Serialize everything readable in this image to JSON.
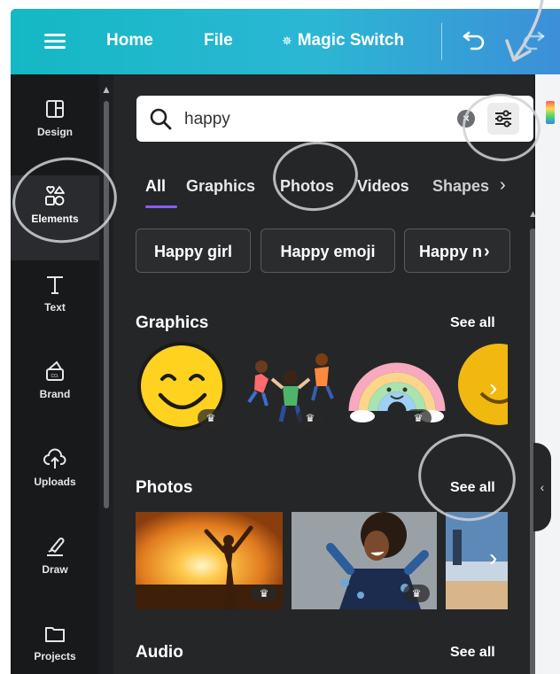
{
  "topbar": {
    "home": "Home",
    "file": "File",
    "magic_switch": "Magic Switch",
    "magic_icon": "✵"
  },
  "sidebar": {
    "items": [
      {
        "label": "Design",
        "icon": "design-icon"
      },
      {
        "label": "Elements",
        "icon": "elements-icon",
        "active": true
      },
      {
        "label": "Text",
        "icon": "text-icon"
      },
      {
        "label": "Brand",
        "icon": "brand-icon"
      },
      {
        "label": "Uploads",
        "icon": "uploads-icon"
      },
      {
        "label": "Draw",
        "icon": "draw-icon"
      },
      {
        "label": "Projects",
        "icon": "projects-icon"
      }
    ]
  },
  "search": {
    "value": "happy",
    "clear_glyph": "×"
  },
  "tabs": [
    "All",
    "Graphics",
    "Photos",
    "Videos",
    "Shapes"
  ],
  "tab_more": "›",
  "chips": [
    "Happy girl",
    "Happy emoji",
    "Happy n"
  ],
  "sections": {
    "graphics": {
      "title": "Graphics",
      "see_all": "See all"
    },
    "photos": {
      "title": "Photos",
      "see_all": "See all"
    },
    "audio": {
      "title": "Audio",
      "see_all": "See all"
    }
  },
  "premium_glyph": "♛",
  "arrow_right": "›",
  "collapse_glyph": "‹",
  "colors": {
    "topbar_start": "#14b8c4",
    "topbar_end": "#3d8fd8",
    "panel_bg": "#252627",
    "rail_bg": "#18191b",
    "tab_underline": "#8b5cf6"
  }
}
